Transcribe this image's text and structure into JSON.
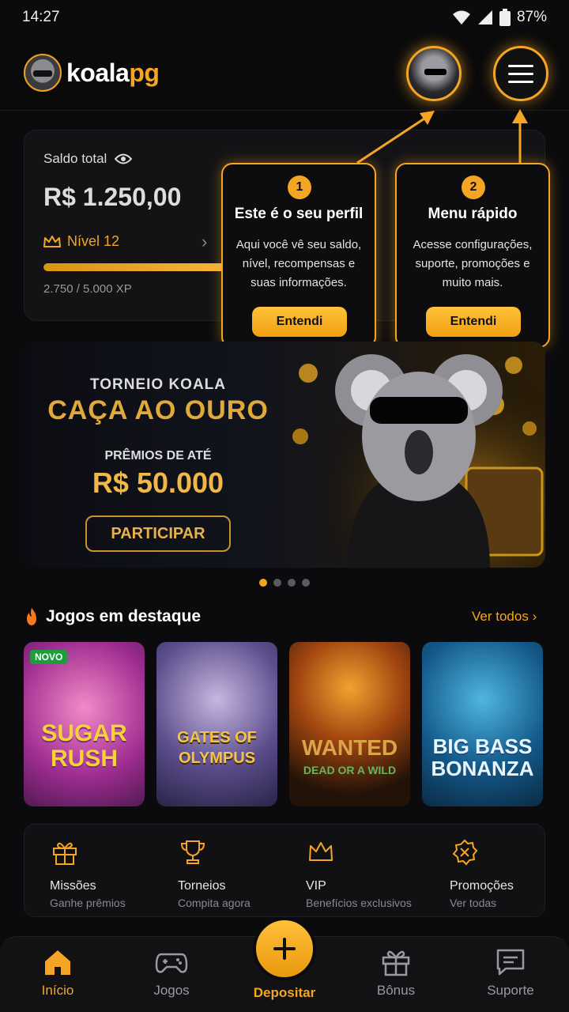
{
  "status": {
    "time": "14:27",
    "battery": "87%"
  },
  "header": {
    "brand_part1": "koala",
    "brand_part2": "pg"
  },
  "balance": {
    "label": "Saldo total",
    "value": "R$ 1.250,00",
    "level": "Nível 12",
    "xp_text": "2.750 / 5.000 XP",
    "xp_progress": 0.55
  },
  "tooltips": [
    {
      "num": "1",
      "title": "Este é o seu perfil",
      "body": "Aqui você vê seu saldo, nível, recompensas e suas informações.",
      "button": "Entendi"
    },
    {
      "num": "2",
      "title": "Menu rápido",
      "body": "Acesse configurações, suporte, promoções e muito mais.",
      "button": "Entendi"
    }
  ],
  "banner": {
    "kicker": "TORNEIO KOALA",
    "title": "CAÇA AO OURO",
    "subtitle": "PRÊMIOS DE ATÉ",
    "prize": "R$ 50.000",
    "button": "PARTICIPAR",
    "active_dot": 1
  },
  "featured": {
    "title": "Jogos em destaque",
    "see_all": "Ver todos",
    "games": [
      {
        "name": "SUGAR RUSH",
        "badge": "NOVO"
      },
      {
        "name": "GATES OF OLYMPUS"
      },
      {
        "name": "WANTED",
        "sub": "DEAD OR A WILD"
      },
      {
        "name": "BIG BASS BONANZA"
      }
    ]
  },
  "quick_links": [
    {
      "label": "Missões",
      "sub": "Ganhe prêmios",
      "icon": "gift-icon"
    },
    {
      "label": "Torneios",
      "sub": "Compita agora",
      "icon": "trophy-icon"
    },
    {
      "label": "VIP",
      "sub": "Benefícios exclusivos",
      "icon": "crown-icon"
    },
    {
      "label": "Promoções",
      "sub": "Ver todas",
      "icon": "promo-badge-icon"
    }
  ],
  "nav": {
    "home": "Início",
    "games": "Jogos",
    "deposit": "Depositar",
    "bonus": "Bônus",
    "support": "Suporte"
  },
  "colors": {
    "accent": "#f5a524",
    "background": "#0b0b0d"
  }
}
